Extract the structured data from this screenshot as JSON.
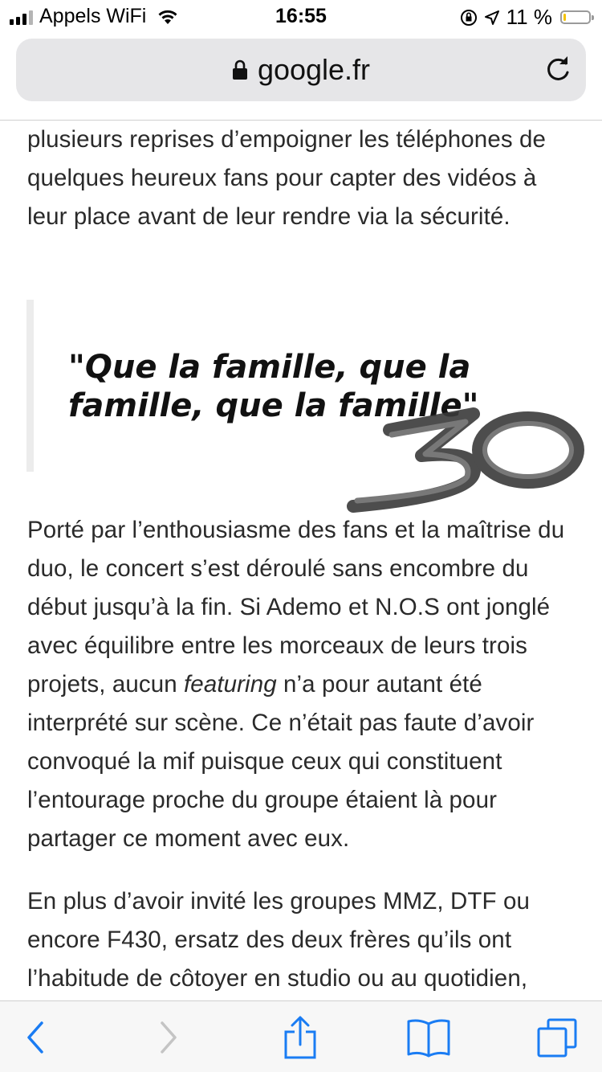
{
  "status_bar": {
    "carrier": "Appels WiFi",
    "time": "16:55",
    "battery_percent": "11 %",
    "battery_level": 0.11
  },
  "address_bar": {
    "url": "google.fr",
    "icons": [
      "lock-icon",
      "reload-icon"
    ]
  },
  "article": {
    "para1": "plusieurs reprises d’empoigner les téléphones de quelques heureux fans pour capter des vidéos à leur place avant de leur rendre via la sécurité.",
    "quote": "\"Que la famille, que la famille, que la famille\"",
    "overlay_mark": "30",
    "para2_before": "Porté par l’enthousiasme des fans et la maîtrise du duo, le concert s’est déroulé sans encombre du début jusqu’à la fin. Si Ademo et N.O.S ont jonglé avec équilibre entre les morceaux de leurs trois projets, aucun ",
    "para2_em": "featuring",
    "para2_after": " n’a pour autant été interprété sur scène. Ce n’était pas faute d’avoir convoqué la mif puisque ceux qui constituent l’entourage proche du groupe étaient là pour partager ce moment avec eux.",
    "para3": "En plus d’avoir invité les groupes MMZ, DTF ou encore F430, ersatz des deux frères qu’ils ont l’habitude de côtoyer en studio ou au quotidien,"
  },
  "toolbar": {
    "icons": [
      "back-icon",
      "forward-icon",
      "share-icon",
      "bookmarks-icon",
      "tabs-icon"
    ]
  },
  "colors": {
    "accent": "#1a7cf3",
    "battery_low": "#f4c200",
    "address_bg": "#e6e6e8",
    "quote_bar": "#ececec"
  }
}
